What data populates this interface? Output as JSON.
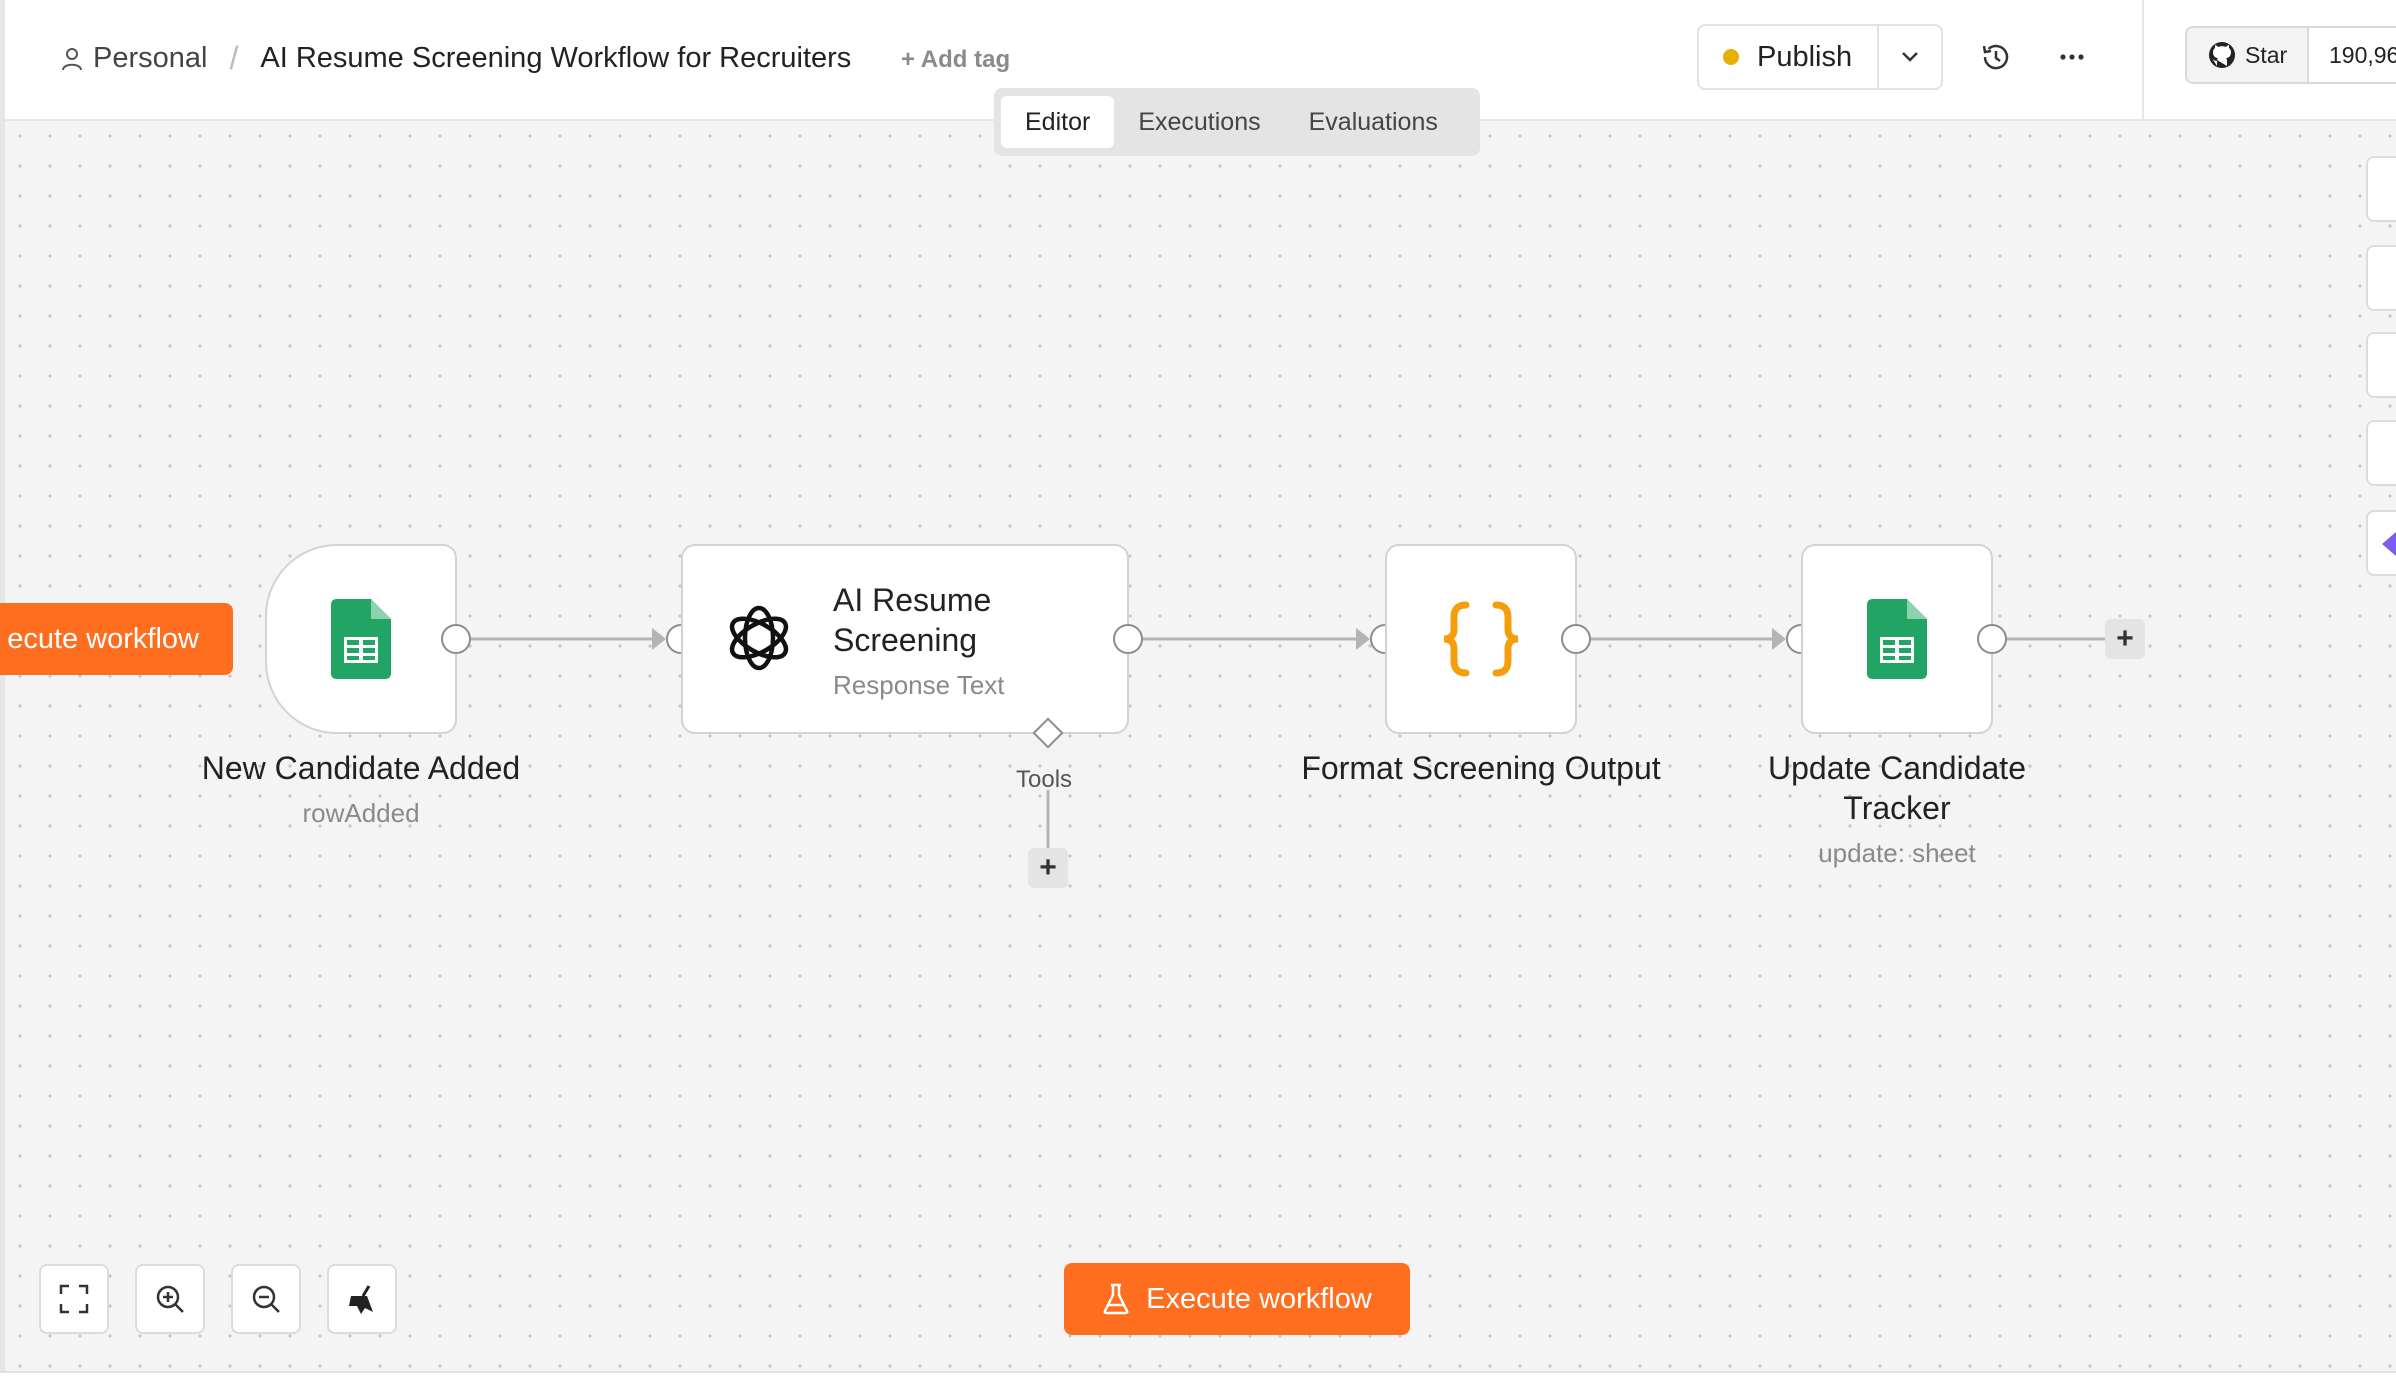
{
  "header": {
    "project": "Personal",
    "separator": "/",
    "workflow_title": "AI Resume Screening Workflow for Recruiters",
    "add_tag": "+ Add tag",
    "publish_label": "Publish",
    "status_color": "#e6b000",
    "github": {
      "star_label": "Star",
      "star_count": "190,96"
    }
  },
  "tabs": [
    {
      "label": "Editor",
      "active": true
    },
    {
      "label": "Executions",
      "active": false
    },
    {
      "label": "Evaluations",
      "active": false
    }
  ],
  "nodes": {
    "trigger": {
      "label": "New Candidate Added",
      "subtitle": "rowAdded",
      "icon": "google-sheets-icon"
    },
    "ai": {
      "title": "AI Resume Screening",
      "subtitle": "Response Text",
      "icon": "openai-icon",
      "tools_label": "Tools"
    },
    "code": {
      "label": "Format Screening Output",
      "icon": "code-braces-icon"
    },
    "update": {
      "label": "Update Candidate Tracker",
      "subtitle": "update: sheet",
      "icon": "google-sheets-icon"
    }
  },
  "buttons": {
    "execute_side": "ecute workflow",
    "execute_main": "Execute workflow",
    "add_node": "+"
  },
  "colors": {
    "accent": "#ff6d1f",
    "sheets_green": "#21a464",
    "code_orange": "#f59e0b"
  }
}
